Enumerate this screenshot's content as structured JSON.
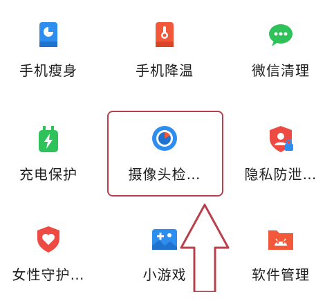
{
  "tiles": [
    {
      "label": "手机瘦身",
      "icon": "phone-slim-icon"
    },
    {
      "label": "手机降温",
      "icon": "thermometer-icon"
    },
    {
      "label": "微信清理",
      "icon": "wechat-icon"
    },
    {
      "label": "充电保护",
      "icon": "charger-icon"
    },
    {
      "label": "摄像头检…",
      "icon": "camera-lens-icon"
    },
    {
      "label": "隐私防泄…",
      "icon": "privacy-shield-icon"
    },
    {
      "label": "女性守护…",
      "icon": "heart-shield-icon"
    },
    {
      "label": "小游戏",
      "icon": "gamepad-icon"
    },
    {
      "label": "软件管理",
      "icon": "android-folder-icon"
    }
  ],
  "colors": {
    "blue": "#2e8ef0",
    "orange": "#f2593a",
    "green": "#2fc25b",
    "red": "#ee4a44",
    "highlight": "#b8404c"
  }
}
